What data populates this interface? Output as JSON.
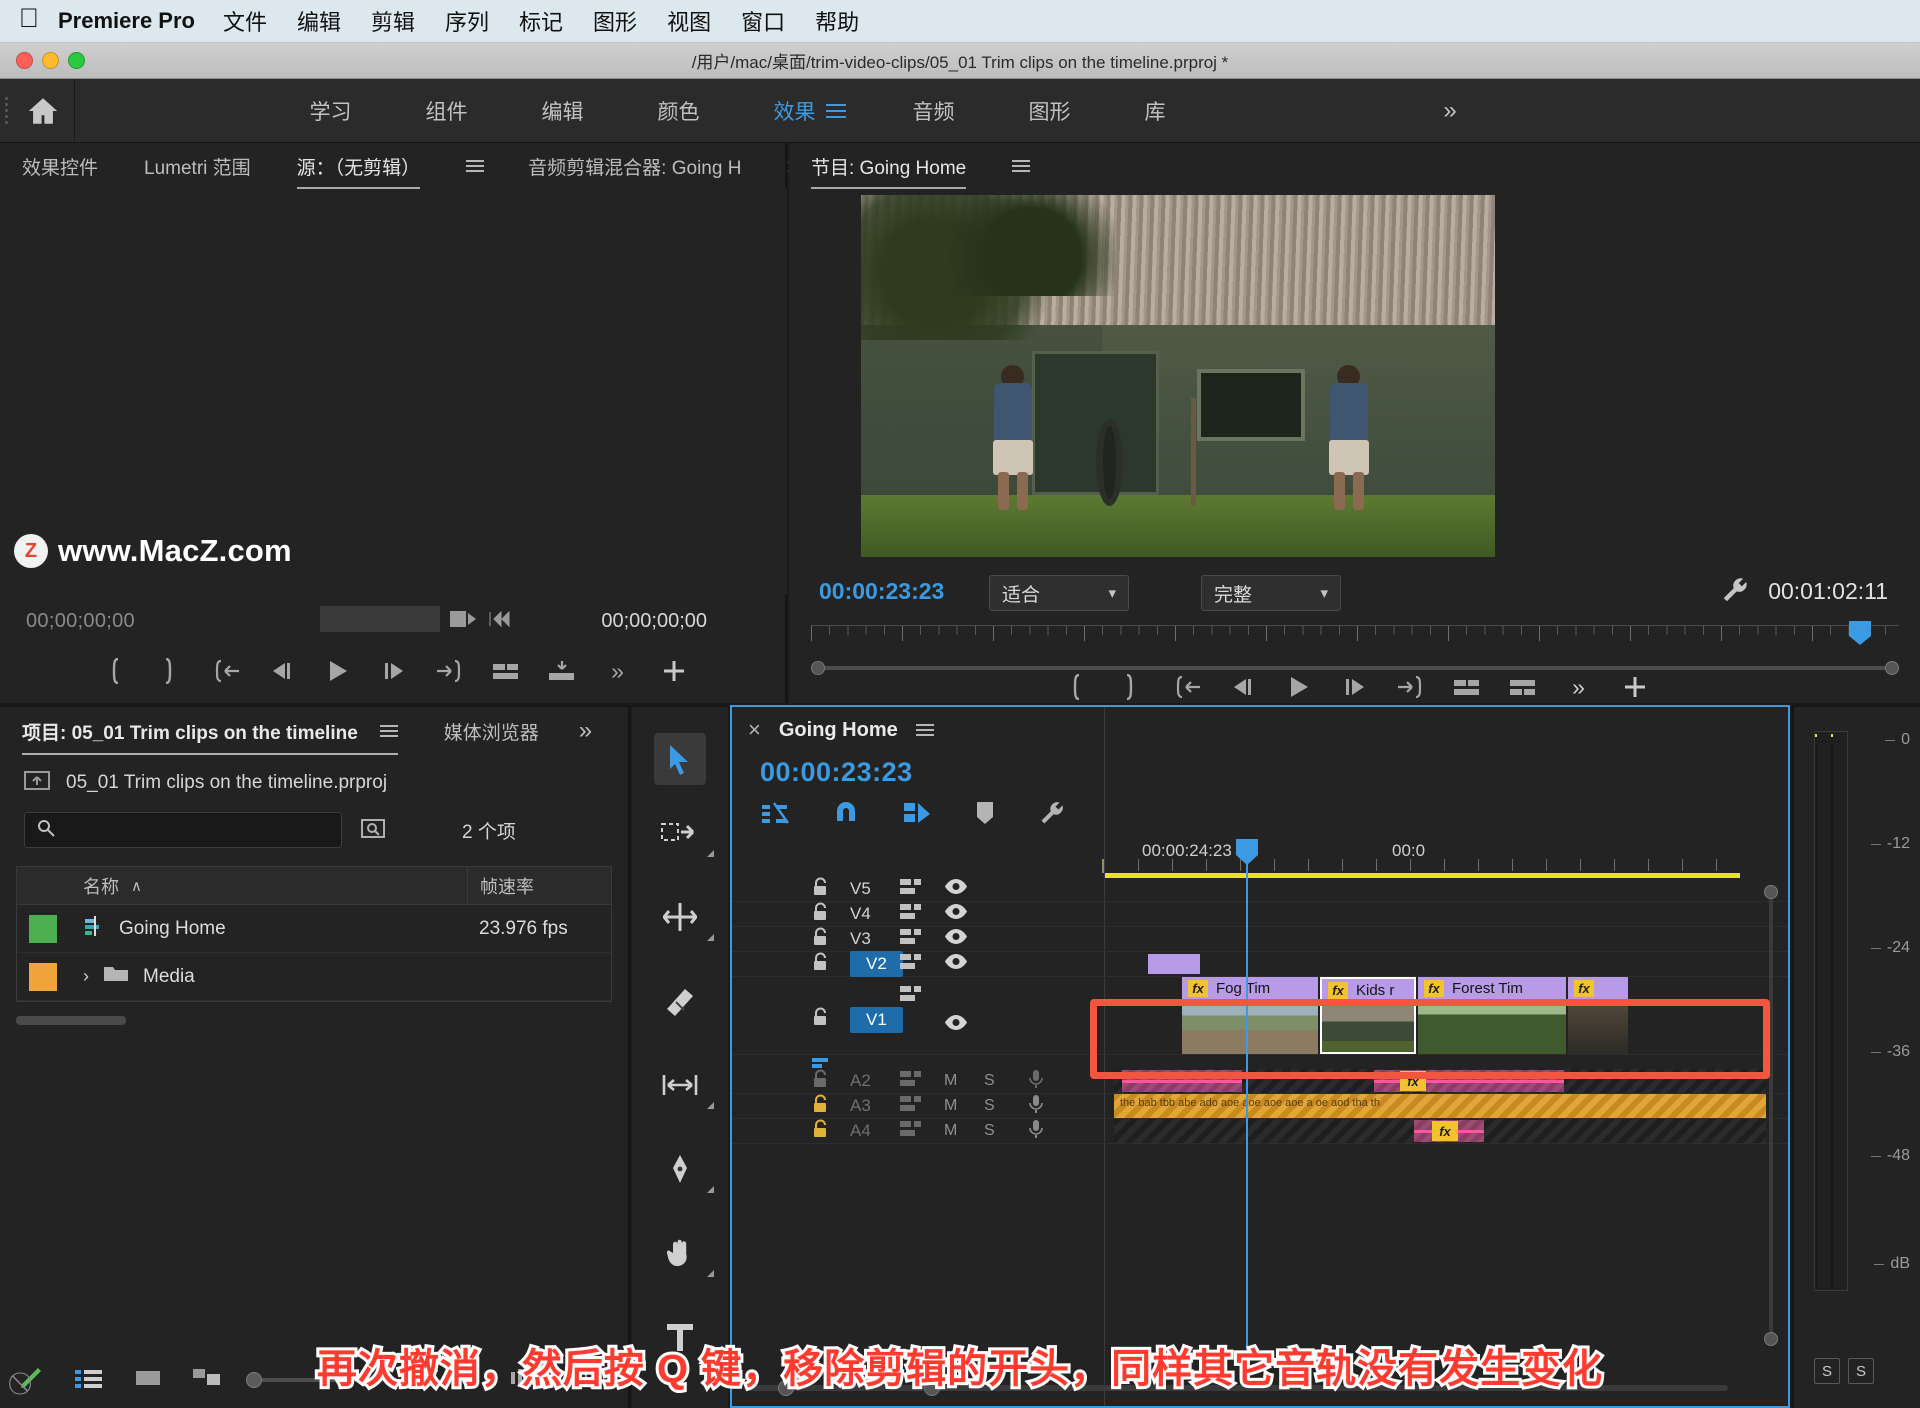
{
  "macmenu": {
    "apple_icon": "apple-icon",
    "app_name": "Premiere Pro",
    "items": [
      "文件",
      "编辑",
      "剪辑",
      "序列",
      "标记",
      "图形",
      "视图",
      "窗口",
      "帮助"
    ]
  },
  "window": {
    "title": "/用户/mac/桌面/trim-video-clips/05_01 Trim clips on the timeline.prproj *"
  },
  "workspace": {
    "home_icon": "home-icon",
    "tabs": [
      "学习",
      "组件",
      "编辑",
      "颜色",
      "效果",
      "音频",
      "图形",
      "库"
    ],
    "active_tab": "效果",
    "more_label": "»"
  },
  "source_panel": {
    "tabs": [
      "效果控件",
      "Lumetri 范围",
      "源：（无剪辑）",
      "音频剪辑混合器: Going H"
    ],
    "active_tab": "源：（无剪辑）",
    "more_label": "»",
    "timecode_left": "00;00;00;00",
    "timecode_right": "00;00;00;00",
    "watermark": "www.MacZ.com",
    "watermark_mark": "Z"
  },
  "program_panel": {
    "title": "节目: Going Home",
    "timecode_current": "00:00:23:23",
    "timecode_duration": "00:01:02:11",
    "fit_label": "适合",
    "quality_label": "完整",
    "wrench_icon": "wrench-icon"
  },
  "project_panel": {
    "title": "项目: 05_01 Trim clips on the timeline",
    "tab_media_browser": "媒体浏览器",
    "more_label": "»",
    "file_name": "05_01 Trim clips on the timeline.prproj",
    "search_placeholder": "",
    "item_count": "2 个项",
    "columns": [
      "名称",
      "帧速率"
    ],
    "sort_indicator": "∧",
    "rows": [
      {
        "swatch": "#4caf50",
        "icon": "sequence-icon",
        "name": "Going Home",
        "frame_rate": "23.976 fps",
        "expandable": false
      },
      {
        "swatch": "#f0a33a",
        "icon": "folder-icon",
        "name": "Media",
        "frame_rate": "",
        "expandable": true
      }
    ]
  },
  "tools": [
    {
      "name": "selection-tool",
      "icon": "arrow-icon",
      "selected": true
    },
    {
      "name": "track-select-forward-tool",
      "icon": "track-select-icon",
      "selected": false
    },
    {
      "name": "ripple-edit-tool",
      "icon": "ripple-edit-icon",
      "selected": false
    },
    {
      "name": "razor-tool",
      "icon": "razor-icon",
      "selected": false
    },
    {
      "name": "slip-tool",
      "icon": "slip-icon",
      "selected": false
    },
    {
      "name": "pen-tool",
      "icon": "pen-icon",
      "selected": false
    },
    {
      "name": "hand-tool",
      "icon": "hand-icon",
      "selected": false
    },
    {
      "name": "type-tool",
      "icon": "type-icon",
      "selected": false
    }
  ],
  "timeline": {
    "sequence_name": "Going Home",
    "timecode": "00:00:23:23",
    "ruler_labels": [
      "00:00:24:23",
      "00:0"
    ],
    "toolbar_icons": [
      "insert-overwrite-icon",
      "snap-icon",
      "linked-selection-icon",
      "marker-icon",
      "settings-wrench-icon"
    ],
    "video_tracks": [
      {
        "label": "V5",
        "locked": false,
        "sync": true,
        "visible": true,
        "targeted": false
      },
      {
        "label": "V4",
        "locked": false,
        "sync": true,
        "visible": true,
        "targeted": false
      },
      {
        "label": "V3",
        "locked": false,
        "sync": true,
        "visible": true,
        "targeted": false
      },
      {
        "label": "V2",
        "locked": false,
        "sync": true,
        "visible": true,
        "targeted": true
      },
      {
        "label": "V1",
        "locked": false,
        "sync": true,
        "visible": true,
        "targeted": true
      }
    ],
    "audio_tracks": [
      {
        "label": "A2",
        "mute": "M",
        "solo": "S",
        "mic": true
      },
      {
        "label": "A3",
        "mute": "M",
        "solo": "S",
        "mic": true
      },
      {
        "label": "A4",
        "mute": "M",
        "solo": "S",
        "mic": true
      }
    ],
    "clips": [
      {
        "track": "V1",
        "label": "Fog Tim",
        "fx": "fx",
        "thumb": "city"
      },
      {
        "track": "V1",
        "label": "Kids r",
        "fx": "fx",
        "thumb": "kids",
        "selected": true
      },
      {
        "track": "V1",
        "label": "Forest Tim",
        "fx": "fx",
        "thumb": "forest"
      },
      {
        "track": "V1",
        "label": "",
        "fx": "fx",
        "thumb": "dark"
      }
    ],
    "audio_clip_text": "the bab tbb abe ado aoe aoe aoe aoe a oe aod tha th"
  },
  "meters": {
    "scale": [
      "0",
      "-12",
      "-24",
      "-36",
      "-48",
      "dB"
    ],
    "solo_buttons": [
      "S",
      "S"
    ]
  },
  "caption": {
    "text": "再次撤消，然后按 Q 键，移除剪辑的开头，同样其它音轨没有发生变化"
  },
  "colors": {
    "accent_blue": "#3b9ae1",
    "clip_purple": "#b79ae8",
    "workbar_yellow": "#e8e229",
    "highlight_red": "#f2563f",
    "audio_pink": "#8d3c63",
    "audio_orange": "#e0a63a"
  }
}
